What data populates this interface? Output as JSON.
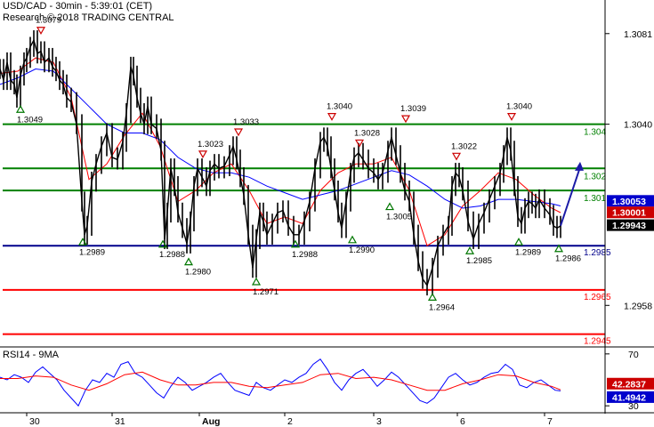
{
  "header": {
    "line1": "USD/CAD - 30min - 5:39:01 (CET)",
    "line2": "Research © 2018 TRADING CENTRAL"
  },
  "rsi_panel": {
    "title": "RSI14 - 9MA"
  },
  "colors": {
    "background": "#ffffff",
    "price": "#000000",
    "ma_fast": "#ff0000",
    "ma_slow": "#0000ff",
    "resistance": "#008000",
    "support_main": "#00008b",
    "support_secondary": "#ff0000",
    "arrow": "#1a1aa6",
    "badge_blue": "#0000cc",
    "badge_red": "#cc0000"
  },
  "chart_data": [
    {
      "type": "line",
      "title": "USD/CAD - 30min",
      "ylim": [
        1.294,
        1.3095
      ],
      "y_ticks": [
        "1.3081",
        "1.3040",
        "1.2958"
      ],
      "x_ticks": [
        "30",
        "31",
        "Aug",
        "2",
        "3",
        "6",
        "7"
      ],
      "grid": false,
      "levels": [
        {
          "label": "1.304",
          "value": 1.304,
          "kind": "resistance"
        },
        {
          "label": "1.302",
          "value": 1.302,
          "kind": "resistance"
        },
        {
          "label": "1.301",
          "value": 1.301,
          "kind": "resistance"
        },
        {
          "label": "1.2985",
          "value": 1.2985,
          "kind": "support_main"
        },
        {
          "label": "1.2965",
          "value": 1.2965,
          "kind": "support"
        },
        {
          "label": "1.2945",
          "value": 1.2945,
          "kind": "support"
        }
      ],
      "current_price_badges": [
        {
          "label": "1.30053",
          "value": 1.30053,
          "color": "blue"
        },
        {
          "label": "1.30001",
          "value": 1.30001,
          "color": "red"
        },
        {
          "label": "1.29943",
          "value": 1.29943,
          "color": "black"
        }
      ],
      "annotations": [
        {
          "label": "1.3079",
          "value": 1.3079,
          "kind": "high"
        },
        {
          "label": "1.3049",
          "value": 1.3049,
          "kind": "low"
        },
        {
          "label": "1.2989",
          "value": 1.2989,
          "kind": "low"
        },
        {
          "label": "1.2988",
          "value": 1.2988,
          "kind": "low"
        },
        {
          "label": "1.2980",
          "value": 1.298,
          "kind": "low"
        },
        {
          "label": "1.3023",
          "value": 1.3023,
          "kind": "high"
        },
        {
          "label": "1.3033",
          "value": 1.3033,
          "kind": "high"
        },
        {
          "label": "1.2971",
          "value": 1.2971,
          "kind": "low"
        },
        {
          "label": "1.2988",
          "value": 1.2988,
          "kind": "low"
        },
        {
          "label": "1.3040",
          "value": 1.304,
          "kind": "high"
        },
        {
          "label": "1.3028",
          "value": 1.3028,
          "kind": "high"
        },
        {
          "label": "1.2990",
          "value": 1.299,
          "kind": "low"
        },
        {
          "label": "1.3039",
          "value": 1.3039,
          "kind": "high"
        },
        {
          "label": "1.3005",
          "value": 1.3005,
          "kind": "low"
        },
        {
          "label": "1.2964",
          "value": 1.2964,
          "kind": "low"
        },
        {
          "label": "1.3022",
          "value": 1.3022,
          "kind": "high"
        },
        {
          "label": "1.2985",
          "value": 1.2985,
          "kind": "low"
        },
        {
          "label": "1.3040",
          "value": 1.304,
          "kind": "high"
        },
        {
          "label": "1.2989",
          "value": 1.2989,
          "kind": "low"
        },
        {
          "label": "1.2986",
          "value": 1.2986,
          "kind": "low"
        }
      ],
      "series": [
        {
          "role": "price",
          "x": [
            0,
            4,
            8,
            12,
            16,
            19,
            23,
            27,
            30,
            34,
            38,
            42,
            46,
            50,
            55,
            59,
            63,
            67,
            71,
            75,
            80,
            86,
            92,
            95,
            98,
            103,
            108,
            114,
            120,
            126,
            132,
            138,
            142,
            147,
            150,
            154,
            158,
            162,
            166,
            170,
            176,
            181,
            185,
            188,
            192,
            196,
            200,
            205,
            210,
            214,
            218,
            222,
            227,
            232,
            236,
            241,
            246,
            252,
            258,
            262,
            266,
            270,
            274,
            279,
            284,
            288,
            292,
            296,
            300,
            306,
            312,
            318,
            324,
            330,
            336,
            342,
            348,
            354,
            360,
            364,
            368,
            372,
            376,
            380,
            384,
            389,
            394,
            398,
            403,
            408,
            414,
            420,
            425,
            430,
            436,
            440,
            445,
            450,
            455,
            460,
            465,
            470,
            475,
            480,
            486,
            492,
            498,
            504,
            508,
            512,
            516,
            520,
            526,
            532,
            538,
            544,
            550,
            556,
            562,
            566,
            570,
            574,
            578,
            582,
            586,
            590,
            594,
            598,
            602,
            606,
            612,
            618,
            622,
            626,
            630
          ],
          "y": [
            1.3065,
            1.306,
            1.3068,
            1.306,
            1.3058,
            1.3052,
            1.3062,
            1.3068,
            1.307,
            1.3075,
            1.3078,
            1.3072,
            1.3073,
            1.3068,
            1.307,
            1.3066,
            1.3064,
            1.306,
            1.3058,
            1.3052,
            1.305,
            1.304,
            1.3005,
            1.299,
            1.2994,
            1.3014,
            1.3022,
            1.303,
            1.3036,
            1.3025,
            1.3024,
            1.3032,
            1.3045,
            1.3066,
            1.3062,
            1.3052,
            1.3045,
            1.304,
            1.3048,
            1.304,
            1.3038,
            1.3028,
            1.2988,
            1.3,
            1.302,
            1.3012,
            1.3,
            1.2993,
            1.2986,
            1.2996,
            1.3012,
            1.302,
            1.3016,
            1.3012,
            1.3019,
            1.3022,
            1.302,
            1.3021,
            1.3026,
            1.303,
            1.3024,
            1.3016,
            1.3008,
            1.299,
            1.2975,
            1.2988,
            1.3,
            1.2996,
            1.299,
            1.2995,
            1.3,
            1.3001,
            1.2994,
            1.299,
            1.299,
            1.2996,
            1.3005,
            1.302,
            1.3032,
            1.3034,
            1.303,
            1.302,
            1.301,
            1.3,
            1.2993,
            1.3005,
            1.3018,
            1.3025,
            1.3027,
            1.3024,
            1.302,
            1.3018,
            1.3015,
            1.3018,
            1.3028,
            1.3034,
            1.3026,
            1.3018,
            1.301,
            1.3005,
            1.299,
            1.2978,
            1.297,
            1.2967,
            1.2975,
            1.2985,
            1.299,
            1.2994,
            1.3012,
            1.3018,
            1.3016,
            1.301,
            1.2996,
            1.2988,
            1.2995,
            1.3,
            1.3006,
            1.3012,
            1.3018,
            1.3026,
            1.3034,
            1.3028,
            1.3012,
            1.2998,
            1.2995,
            1.3002,
            1.3005,
            1.3004,
            1.3002,
            1.3006,
            1.3002,
            1.2999,
            1.2994,
            1.2993,
            1.2994
          ]
        },
        {
          "name": "",
          "role": "ma_fast",
          "x": [
            0,
            20,
            40,
            60,
            80,
            100,
            120,
            140,
            160,
            180,
            200,
            220,
            240,
            260,
            280,
            300,
            320,
            340,
            360,
            380,
            400,
            420,
            440,
            460,
            480,
            500,
            520,
            540,
            560,
            580,
            600,
            620,
            630
          ],
          "y": [
            1.3063,
            1.3064,
            1.307,
            1.3068,
            1.3052,
            1.3015,
            1.3022,
            1.3035,
            1.3045,
            1.303,
            1.3005,
            1.301,
            1.3018,
            1.3022,
            1.301,
            1.2995,
            1.2998,
            1.2995,
            1.301,
            1.3018,
            1.3022,
            1.3022,
            1.3025,
            1.301,
            1.2985,
            1.299,
            1.3003,
            1.301,
            1.3018,
            1.3015,
            1.3008,
            1.3002,
            1.3
          ]
        },
        {
          "name": "",
          "role": "ma_slow",
          "x": [
            0,
            20,
            40,
            60,
            80,
            100,
            120,
            140,
            160,
            180,
            200,
            220,
            240,
            260,
            280,
            300,
            320,
            340,
            360,
            380,
            400,
            420,
            440,
            460,
            480,
            500,
            520,
            540,
            560,
            580,
            600,
            620,
            630
          ],
          "y": [
            1.3058,
            1.3061,
            1.3065,
            1.3064,
            1.3056,
            1.3048,
            1.304,
            1.3036,
            1.3036,
            1.3033,
            1.3025,
            1.302,
            1.3018,
            1.3018,
            1.3016,
            1.3012,
            1.3009,
            1.3006,
            1.3008,
            1.301,
            1.3013,
            1.3016,
            1.3019,
            1.3017,
            1.3012,
            1.3006,
            1.3002,
            1.3003,
            1.3006,
            1.3006,
            1.3005,
            1.3004,
            1.3003
          ]
        }
      ],
      "forecast_arrow": {
        "from": [
          630,
          1.2994
        ],
        "to": [
          652,
          1.3023
        ]
      }
    },
    {
      "type": "line",
      "title": "RSI14 - 9MA",
      "ylim": [
        26,
        74
      ],
      "y_ticks": [
        "70",
        "30"
      ],
      "badges": [
        {
          "label": "42.2837",
          "value": 42.2837,
          "color": "red"
        },
        {
          "label": "41.4942",
          "value": 41.4942,
          "color": "blue"
        }
      ],
      "series": [
        {
          "role": "rsi",
          "x": [
            0,
            8,
            16,
            24,
            32,
            40,
            48,
            56,
            64,
            72,
            80,
            88,
            96,
            104,
            112,
            120,
            128,
            136,
            144,
            152,
            160,
            168,
            176,
            184,
            192,
            200,
            208,
            216,
            224,
            232,
            240,
            248,
            256,
            264,
            272,
            280,
            288,
            296,
            304,
            312,
            320,
            328,
            336,
            344,
            352,
            360,
            368,
            376,
            384,
            392,
            400,
            408,
            416,
            424,
            432,
            440,
            448,
            456,
            464,
            472,
            480,
            488,
            496,
            504,
            512,
            520,
            528,
            536,
            544,
            552,
            560,
            568,
            576,
            584,
            592,
            600,
            608,
            616,
            624,
            630
          ],
          "y": [
            52,
            50,
            54,
            52,
            48,
            56,
            60,
            55,
            50,
            42,
            36,
            30,
            42,
            50,
            48,
            55,
            52,
            62,
            64,
            55,
            52,
            46,
            40,
            36,
            45,
            52,
            48,
            42,
            45,
            48,
            52,
            55,
            48,
            42,
            40,
            38,
            48,
            44,
            42,
            46,
            50,
            48,
            52,
            55,
            62,
            66,
            58,
            48,
            42,
            50,
            55,
            58,
            52,
            45,
            50,
            56,
            52,
            46,
            40,
            34,
            32,
            36,
            44,
            52,
            55,
            50,
            46,
            48,
            52,
            55,
            56,
            62,
            58,
            46,
            44,
            48,
            50,
            46,
            42,
            41.5
          ]
        },
        {
          "role": "rsi_ma",
          "x": [
            0,
            20,
            40,
            60,
            80,
            100,
            120,
            140,
            160,
            180,
            200,
            220,
            240,
            260,
            280,
            300,
            320,
            340,
            360,
            380,
            400,
            420,
            440,
            460,
            480,
            500,
            520,
            540,
            560,
            580,
            600,
            620,
            630
          ],
          "y": [
            51,
            51,
            53,
            52,
            46,
            42,
            47,
            54,
            56,
            50,
            46,
            46,
            48,
            48,
            45,
            44,
            46,
            48,
            54,
            55,
            51,
            52,
            50,
            46,
            42,
            42,
            47,
            50,
            54,
            53,
            48,
            45,
            42.3
          ]
        }
      ]
    }
  ]
}
